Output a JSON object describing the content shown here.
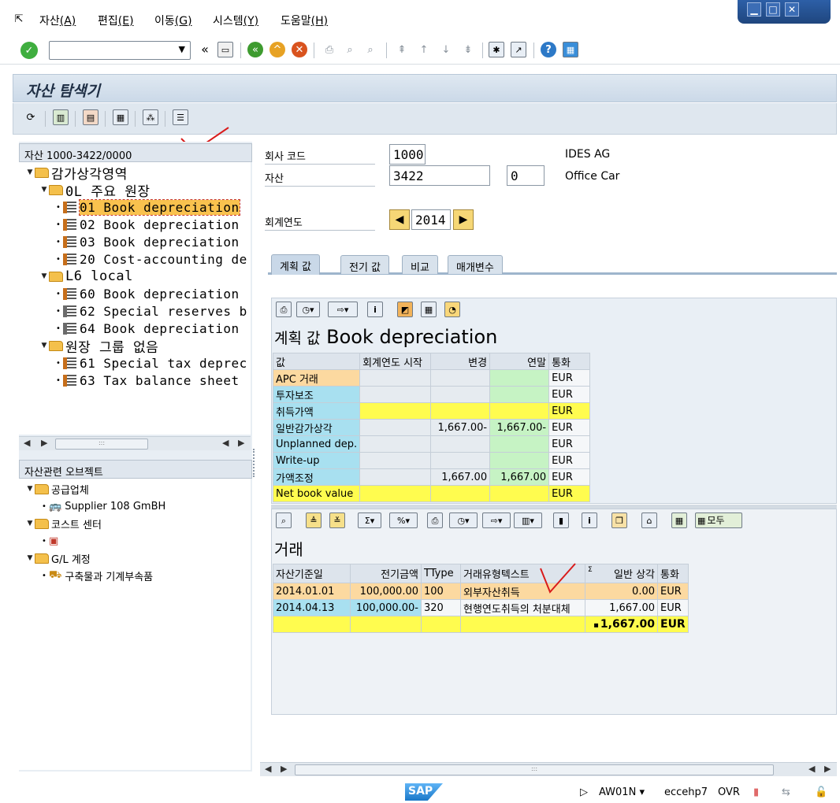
{
  "menu": [
    {
      "label": "자산",
      "key": "(A)"
    },
    {
      "label": "편집",
      "key": "(E)"
    },
    {
      "label": "이동",
      "key": "(G)"
    },
    {
      "label": "시스템",
      "key": "(Y)"
    },
    {
      "label": "도움말",
      "key": "(H)"
    }
  ],
  "window": {
    "title": "자산 탐색기"
  },
  "left_panel": {
    "header": "자산 1000-3422/0000",
    "tree": [
      {
        "level": 0,
        "type": "folder",
        "label": "감가상각영역"
      },
      {
        "level": 1,
        "type": "folder",
        "label": "0L 주요 원장"
      },
      {
        "level": 2,
        "type": "ledger",
        "label": "01 Book depreciation",
        "selected": true
      },
      {
        "level": 2,
        "type": "ledger",
        "label": "02 Book depreciation"
      },
      {
        "level": 2,
        "type": "ledger",
        "label": "03 Book depreciation"
      },
      {
        "level": 2,
        "type": "ledger",
        "label": "20 Cost-accounting de"
      },
      {
        "level": 1,
        "type": "folder",
        "label": "L6 local"
      },
      {
        "level": 2,
        "type": "ledger",
        "label": "60 Book depreciation"
      },
      {
        "level": 2,
        "type": "ledger2",
        "label": "62 Special reserves b"
      },
      {
        "level": 2,
        "type": "ledger2",
        "label": "64 Book depreciation"
      },
      {
        "level": 1,
        "type": "folder",
        "label": " 원장 그룹 없음"
      },
      {
        "level": 2,
        "type": "ledger",
        "label": "61 Special tax deprec"
      },
      {
        "level": 2,
        "type": "ledger",
        "label": "63 Tax balance sheet"
      }
    ],
    "related_header": "자산관련 오브젝트",
    "related": [
      {
        "level": 0,
        "type": "folder",
        "label": "공급업체"
      },
      {
        "level": 1,
        "type": "supplier",
        "label": "Supplier 108 GmBH"
      },
      {
        "level": 0,
        "type": "folder",
        "label": "코스트 센터"
      },
      {
        "level": 1,
        "type": "costcenter",
        "label": ""
      },
      {
        "level": 0,
        "type": "folder",
        "label": "G/L 계정"
      },
      {
        "level": 1,
        "type": "gl",
        "label": "구축물과 기계부속품"
      }
    ]
  },
  "header_fields": {
    "company_code_label": "회사 코드",
    "company_code": "1000",
    "company_name": "IDES AG",
    "asset_label": "자산",
    "asset_number": "3422",
    "asset_sub": "0",
    "asset_name": "Office Car",
    "fiscal_year_label": "회계연도",
    "fiscal_year": "2014"
  },
  "tabs": [
    "계획 값",
    "전기 값",
    "비교",
    "매개변수"
  ],
  "planned": {
    "title_prefix": "계획 값",
    "title": "Book depreciation",
    "columns": [
      "값",
      "회계연도 시작",
      "변경",
      "연말",
      "통화"
    ],
    "rows": [
      {
        "label": "APC 거래",
        "start": "",
        "change": "",
        "year_end": "",
        "currency": "EUR"
      },
      {
        "label": "투자보조",
        "start": "",
        "change": "",
        "year_end": "",
        "currency": "EUR"
      },
      {
        "label": "취득가액",
        "start": "",
        "change": "",
        "year_end": "",
        "currency": "EUR"
      },
      {
        "label": "일반감가상각",
        "start": "",
        "change": "1,667.00-",
        "year_end": "1,667.00-",
        "currency": "EUR"
      },
      {
        "label": "Unplanned dep.",
        "start": "",
        "change": "",
        "year_end": "",
        "currency": "EUR"
      },
      {
        "label": "Write-up",
        "start": "",
        "change": "",
        "year_end": "",
        "currency": "EUR"
      },
      {
        "label": "가액조정",
        "start": "",
        "change": "1,667.00",
        "year_end": "1,667.00",
        "currency": "EUR"
      },
      {
        "label": "Net book value",
        "start": "",
        "change": "",
        "year_end": "",
        "currency": "EUR"
      }
    ]
  },
  "transactions": {
    "title": "거래",
    "all_button": "모두",
    "columns": [
      "자산기준일",
      "전기금액",
      "TType",
      "거래유형텍스트",
      "Σ",
      "일반 상각",
      "통화"
    ],
    "rows": [
      {
        "date": "2014.01.01",
        "amount": "100,000.00",
        "ttype": "100",
        "text": "외부자산취득",
        "ordinary": "0.00",
        "currency": "EUR"
      },
      {
        "date": "2014.04.13",
        "amount": "100,000.00-",
        "ttype": "320",
        "text": "현행연도취득의 처분대체",
        "ordinary": "1,667.00",
        "currency": "EUR"
      }
    ],
    "total_marker": "▪",
    "total": "1,667.00",
    "total_currency": "EUR"
  },
  "status": {
    "logo": "SAP",
    "transaction": "AW01N",
    "server": "eccehp7",
    "mode": "OVR"
  }
}
